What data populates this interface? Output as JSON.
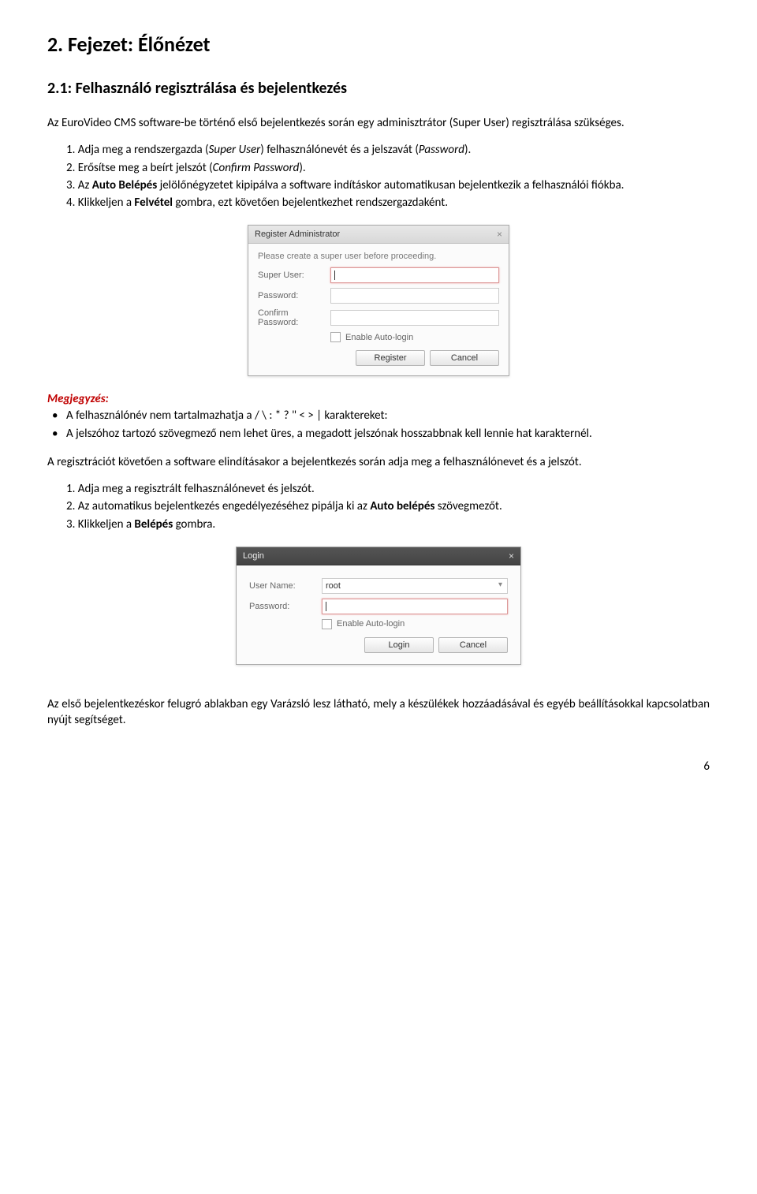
{
  "headings": {
    "chapter": "2. Fejezet: Élőnézet",
    "section": "2.1: Felhasználó regisztrálása és bejelentkezés"
  },
  "intro": "Az EuroVideo CMS software-be történő első bejelentkezés során egy adminisztrátor (Super User) regisztrálása szükséges.",
  "steps1": {
    "s1_pre": "1. Adja meg a rendszergazda (",
    "s1_i1": "Super User",
    "s1_mid": ") felhasználónevét és a jelszavát (",
    "s1_i2": "Password",
    "s1_post": ").",
    "s2_pre": "2. Erősítse meg a beírt jelszót (",
    "s2_i": "Confirm Password",
    "s2_post": ").",
    "s3_pre": "3. Az ",
    "s3_b": "Auto Belépés",
    "s3_post": " jelölőnégyzetet kipipálva a software indításkor automatikusan bejelentkezik a felhasználói fiókba.",
    "s4_pre": "4. Klikkeljen a ",
    "s4_b": "Felvétel",
    "s4_post": " gombra, ezt követően bejelentkezhet rendszergazdaként."
  },
  "register_dialog": {
    "title": "Register Administrator",
    "hint": "Please create a super user before proceeding.",
    "labels": {
      "super_user": "Super User:",
      "password": "Password:",
      "confirm": "Confirm Password:"
    },
    "autologin": "Enable Auto-login",
    "buttons": {
      "register": "Register",
      "cancel": "Cancel"
    }
  },
  "note": {
    "title": "Megjegyzés:",
    "b1": "A felhasználónév nem tartalmazhatja a / \\ : * ? \" < > | karaktereket:",
    "b2": "A jelszóhoz tartozó szövegmező nem lehet üres, a megadott jelszónak hosszabbnak kell lennie hat karakternél."
  },
  "after_reg": "A regisztrációt követően a software elindításakor a bejelentkezés során adja meg a felhasználónevet és a jelszót.",
  "steps2": {
    "s1": "1. Adja meg a regisztrált felhasználónevet és jelszót.",
    "s2_pre": "2. Az automatikus bejelentkezés engedélyezéséhez pipálja ki az ",
    "s2_b": "Auto belépés",
    "s2_post": " szövegmezőt.",
    "s3_pre": "3. Klikkeljen a ",
    "s3_b": "Belépés",
    "s3_post": " gombra."
  },
  "login_dialog": {
    "title": "Login",
    "labels": {
      "user": "User Name:",
      "password": "Password:"
    },
    "user_value": "root",
    "autologin": "Enable Auto-login",
    "buttons": {
      "login": "Login",
      "cancel": "Cancel"
    }
  },
  "closing": "Az első bejelentkezéskor felugró ablakban egy Varázsló lesz látható, mely a készülékek hozzáadásával és egyéb beállításokkal kapcsolatban nyújt segítséget.",
  "page_number": "6"
}
